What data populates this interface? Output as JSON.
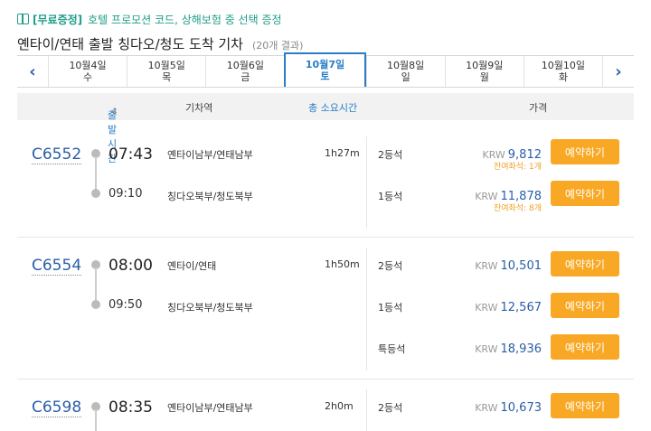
{
  "promo": {
    "tag": "[무료증정]",
    "text": "호텔 프로모션 코드, 상해보험 중 선택 증정"
  },
  "heading": {
    "title": "옌타이/연태 출발 칭다오/청도 도착 기차",
    "count": "(20개 결과)"
  },
  "dates": [
    {
      "date": "10월4일",
      "day": "수"
    },
    {
      "date": "10월5일",
      "day": "목"
    },
    {
      "date": "10월6일",
      "day": "금"
    },
    {
      "date": "10월7일",
      "day": "토"
    },
    {
      "date": "10월8일",
      "day": "일"
    },
    {
      "date": "10월9일",
      "day": "월"
    },
    {
      "date": "10월10일",
      "day": "화"
    }
  ],
  "columns": {
    "departure": "출발시간",
    "sort_icon": "⇕",
    "station": "기차역",
    "duration": "총 소요시간",
    "price": "가격"
  },
  "currency": "KRW",
  "book_label": "예약하기",
  "trains": [
    {
      "no": "C6552",
      "dep_time": "07:43",
      "arr_time": "09:10",
      "dep_station": "옌타이남부/연태남부",
      "arr_station": "칭다오북부/청도북부",
      "duration": "1h27m",
      "seats": [
        {
          "class": "2등석",
          "price": "9,812",
          "remaining": "잔여좌석: 1개"
        },
        {
          "class": "1등석",
          "price": "11,878",
          "remaining": "잔여좌석: 8개"
        }
      ]
    },
    {
      "no": "C6554",
      "dep_time": "08:00",
      "arr_time": "09:50",
      "dep_station": "옌타이/연태",
      "arr_station": "칭다오북부/청도북부",
      "duration": "1h50m",
      "seats": [
        {
          "class": "2등석",
          "price": "10,501"
        },
        {
          "class": "1등석",
          "price": "12,567"
        },
        {
          "class": "특등석",
          "price": "18,936"
        }
      ]
    },
    {
      "no": "C6598",
      "dep_time": "08:35",
      "dep_station": "옌타이남부/연태남부",
      "duration": "2h0m",
      "seats": [
        {
          "class": "2등석",
          "price": "10,673"
        }
      ]
    }
  ]
}
